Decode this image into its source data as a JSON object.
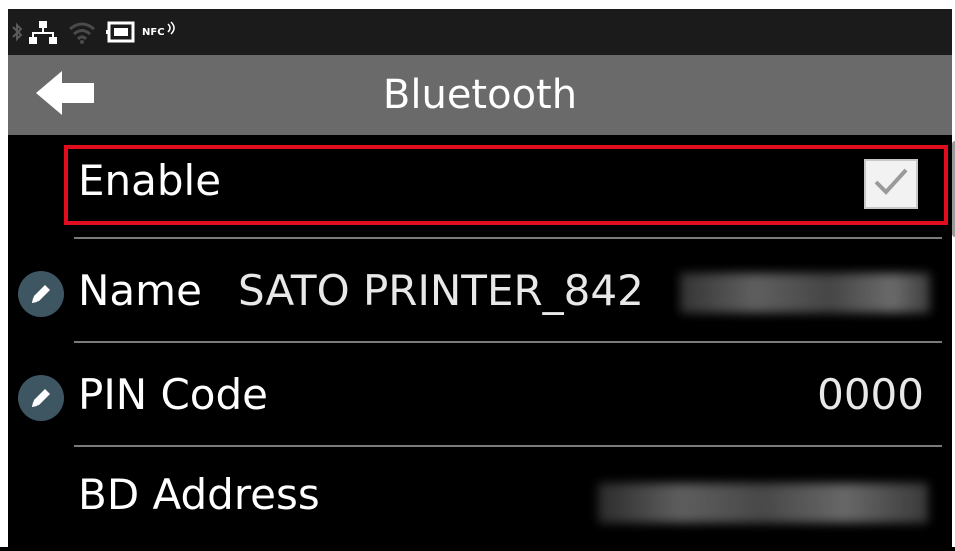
{
  "status_bar": {
    "icons": [
      "bluetooth-icon",
      "ethernet-icon",
      "wifi-icon",
      "card-icon",
      "nfc-icon"
    ],
    "nfc_label": "NFC"
  },
  "header": {
    "title": "Bluetooth",
    "back_icon": "arrow-left-icon"
  },
  "settings": {
    "enable": {
      "label": "Enable",
      "checked": true
    },
    "name": {
      "label": "Name",
      "value": "SATO PRINTER_842",
      "value_redacted": true
    },
    "pin_code": {
      "label": "PIN Code",
      "value": "0000"
    },
    "bd_address": {
      "label": "BD Address",
      "value_redacted": true
    }
  },
  "colors": {
    "title_bar": "#6a6a6a",
    "status_bar": "#1b1b1b",
    "highlight": "#e00d1e",
    "edit_icon_bg": "#3e5562",
    "background": "#000000"
  }
}
